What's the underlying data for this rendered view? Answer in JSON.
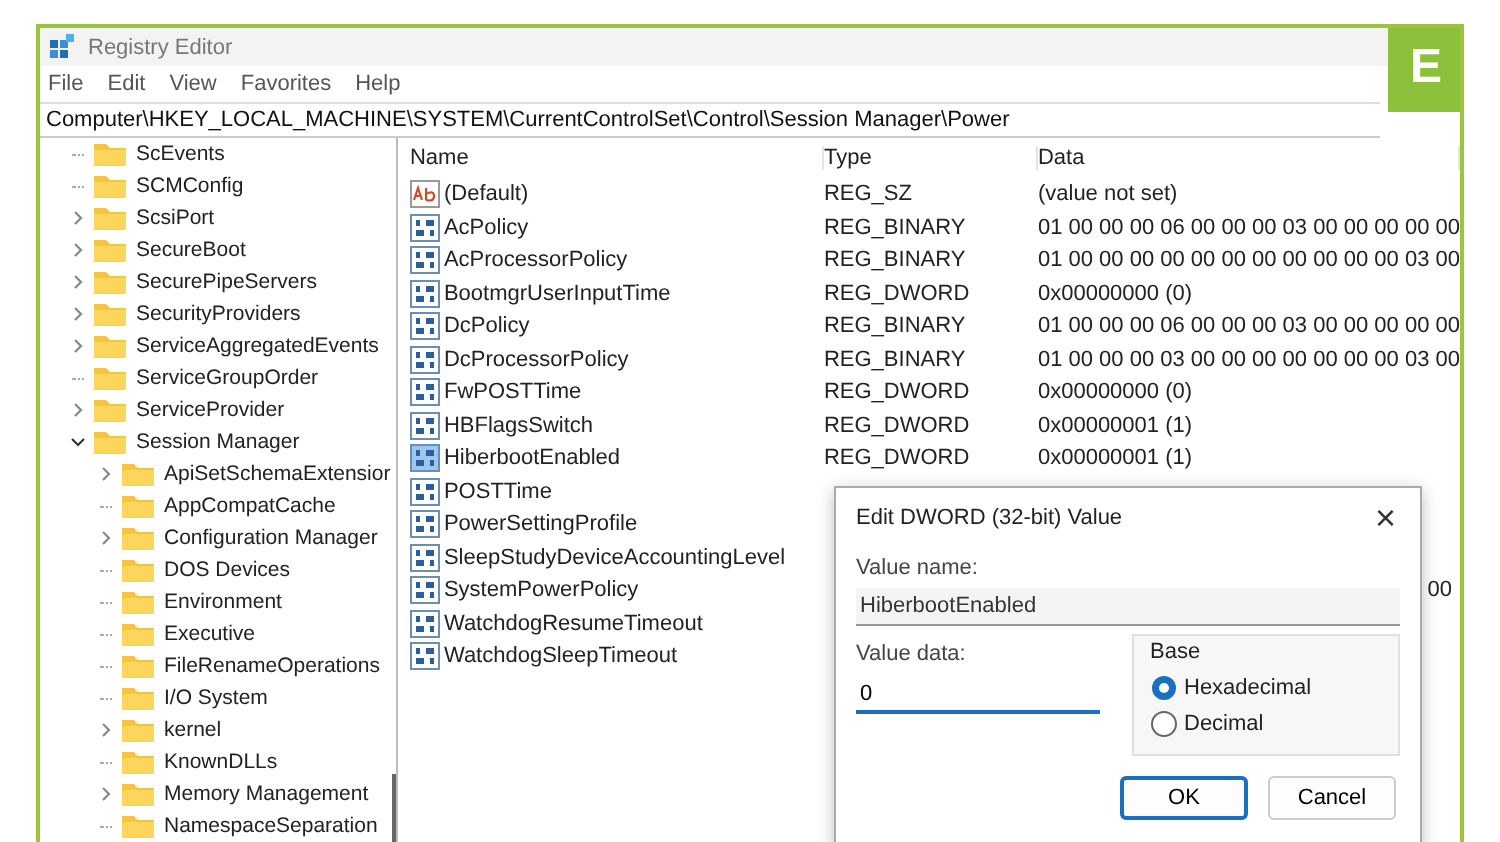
{
  "window": {
    "title": "Registry Editor"
  },
  "badge": "E",
  "menu": [
    "File",
    "Edit",
    "View",
    "Favorites",
    "Help"
  ],
  "address": "Computer\\HKEY_LOCAL_MACHINE\\SYSTEM\\CurrentControlSet\\Control\\Session Manager\\Power",
  "tree": [
    {
      "kind": "leaf",
      "label": "ScEvents"
    },
    {
      "kind": "leaf",
      "label": "SCMConfig"
    },
    {
      "kind": "collapsed",
      "label": "ScsiPort"
    },
    {
      "kind": "collapsed",
      "label": "SecureBoot"
    },
    {
      "kind": "collapsed",
      "label": "SecurePipeServers"
    },
    {
      "kind": "collapsed",
      "label": "SecurityProviders"
    },
    {
      "kind": "collapsed",
      "label": "ServiceAggregatedEvents"
    },
    {
      "kind": "leaf",
      "label": "ServiceGroupOrder"
    },
    {
      "kind": "collapsed",
      "label": "ServiceProvider"
    },
    {
      "kind": "expanded",
      "label": "Session Manager",
      "children": [
        {
          "kind": "collapsed",
          "label": "ApiSetSchemaExtensior"
        },
        {
          "kind": "leaf",
          "label": "AppCompatCache"
        },
        {
          "kind": "collapsed",
          "label": "Configuration Manager"
        },
        {
          "kind": "leaf",
          "label": "DOS Devices"
        },
        {
          "kind": "leaf",
          "label": "Environment"
        },
        {
          "kind": "leaf",
          "label": "Executive"
        },
        {
          "kind": "leaf",
          "label": "FileRenameOperations"
        },
        {
          "kind": "leaf",
          "label": "I/O System"
        },
        {
          "kind": "collapsed",
          "label": "kernel"
        },
        {
          "kind": "leaf",
          "label": "KnownDLLs"
        },
        {
          "kind": "collapsed",
          "label": "Memory Management"
        },
        {
          "kind": "leaf",
          "label": "NamespaceSeparation"
        }
      ]
    }
  ],
  "table": {
    "columns": [
      "Name",
      "Type",
      "Data"
    ],
    "rows": [
      {
        "kind": "string",
        "name": "(Default)",
        "type": "REG_SZ",
        "data": "(value not set)",
        "selected": false
      },
      {
        "kind": "binary",
        "name": "AcPolicy",
        "type": "REG_BINARY",
        "data": "01 00 00 00 06 00 00 00 03 00 00 00 00 00",
        "selected": false
      },
      {
        "kind": "binary",
        "name": "AcProcessorPolicy",
        "type": "REG_BINARY",
        "data": "01 00 00 00 00 00 00 00 00 00 00 00 03 00",
        "selected": false
      },
      {
        "kind": "binary",
        "name": "BootmgrUserInputTime",
        "type": "REG_DWORD",
        "data": "0x00000000 (0)",
        "selected": false
      },
      {
        "kind": "binary",
        "name": "DcPolicy",
        "type": "REG_BINARY",
        "data": "01 00 00 00 06 00 00 00 03 00 00 00 00 00",
        "selected": false
      },
      {
        "kind": "binary",
        "name": "DcProcessorPolicy",
        "type": "REG_BINARY",
        "data": "01 00 00 00 03 00 00 00 00 00 00 00 03 00",
        "selected": false
      },
      {
        "kind": "binary",
        "name": "FwPOSTTime",
        "type": "REG_DWORD",
        "data": "0x00000000 (0)",
        "selected": false
      },
      {
        "kind": "binary",
        "name": "HBFlagsSwitch",
        "type": "REG_DWORD",
        "data": "0x00000001 (1)",
        "selected": false
      },
      {
        "kind": "binary",
        "name": "HiberbootEnabled",
        "type": "REG_DWORD",
        "data": "0x00000001 (1)",
        "selected": true
      },
      {
        "kind": "binary",
        "name": "POSTTime",
        "selected": false
      },
      {
        "kind": "binary",
        "name": "PowerSettingProfile",
        "selected": false
      },
      {
        "kind": "binary",
        "name": "SleepStudyDeviceAccountingLevel",
        "selected": false
      },
      {
        "kind": "binary",
        "name": "SystemPowerPolicy",
        "data": "00",
        "selected": false
      },
      {
        "kind": "binary",
        "name": "WatchdogResumeTimeout",
        "selected": false
      },
      {
        "kind": "binary",
        "name": "WatchdogSleepTimeout",
        "selected": false
      }
    ]
  },
  "dialog": {
    "title": "Edit DWORD (32-bit) Value",
    "close": "×",
    "value_name_label": "Value name:",
    "value_name": "HiberbootEnabled",
    "value_data_label": "Value data:",
    "value_data": "0",
    "base_label": "Base",
    "base_options": [
      {
        "label": "Hexadecimal",
        "selected": true
      },
      {
        "label": "Decimal",
        "selected": false
      }
    ],
    "buttons": [
      {
        "label": "OK",
        "focused": true
      },
      {
        "label": "Cancel",
        "focused": false
      }
    ]
  }
}
